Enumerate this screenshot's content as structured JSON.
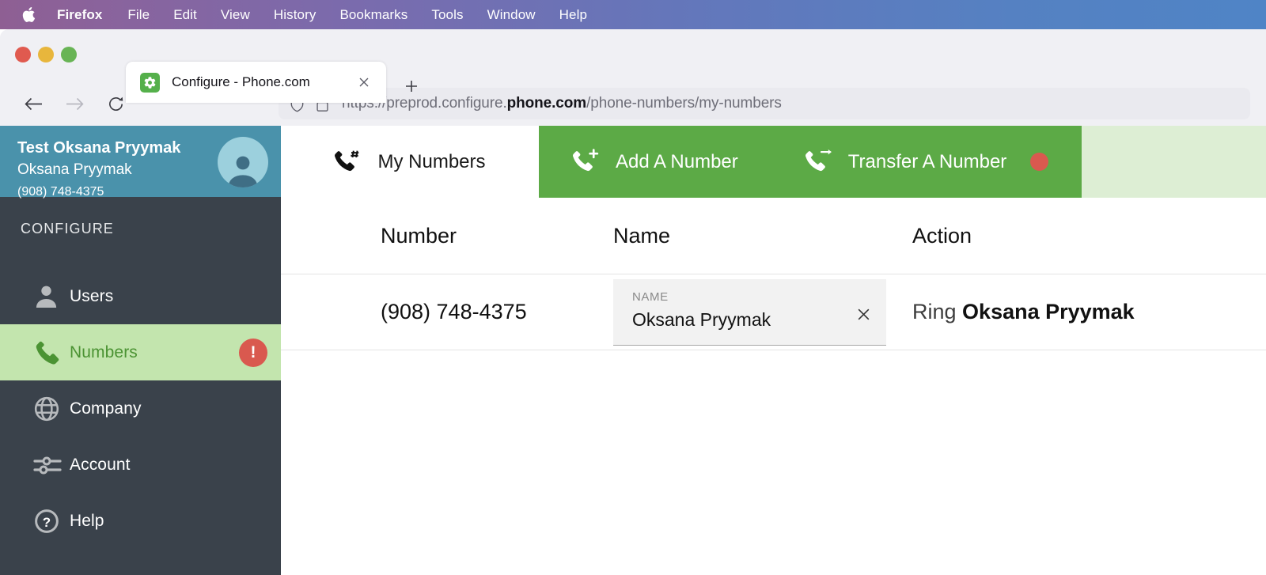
{
  "os_menu": {
    "apple_icon": "apple-logo-icon",
    "items": [
      {
        "label": "Firefox",
        "bold": true
      },
      {
        "label": "File",
        "bold": false
      },
      {
        "label": "Edit",
        "bold": false
      },
      {
        "label": "View",
        "bold": false
      },
      {
        "label": "History",
        "bold": false
      },
      {
        "label": "Bookmarks",
        "bold": false
      },
      {
        "label": "Tools",
        "bold": false
      },
      {
        "label": "Window",
        "bold": false
      },
      {
        "label": "Help",
        "bold": false
      }
    ]
  },
  "browser": {
    "tab": {
      "title": "Configure - Phone.com",
      "favicon_icon": "gear-icon",
      "close_icon": "close-icon"
    },
    "new_tab_icon": "plus-icon",
    "nav": {
      "back_icon": "arrow-left-icon",
      "forward_icon": "arrow-right-icon",
      "reload_icon": "reload-icon"
    },
    "urlbar": {
      "shield_icon": "shield-icon",
      "lock_icon": "lock-icon",
      "url_prefix": "https://preprod.configure.",
      "url_host": "phone.com",
      "url_path": "/phone-numbers/my-numbers"
    }
  },
  "sidebar": {
    "account": {
      "company": "Test Oksana Pryymak",
      "user": "Oksana Pryymak",
      "phone": "(908) 748-4375",
      "avatar_icon": "user-avatar-icon"
    },
    "section_title": "CONFIGURE",
    "items": [
      {
        "label": "Users",
        "icon": "user-icon",
        "active": false,
        "badge": ""
      },
      {
        "label": "Numbers",
        "icon": "phone-icon",
        "active": true,
        "badge": "!"
      },
      {
        "label": "Company",
        "icon": "globe-icon",
        "active": false,
        "badge": ""
      },
      {
        "label": "Account",
        "icon": "sliders-icon",
        "active": false,
        "badge": ""
      },
      {
        "label": "Help",
        "icon": "help-circle-icon",
        "active": false,
        "badge": ""
      }
    ]
  },
  "main": {
    "tabs": [
      {
        "label": "My Numbers",
        "icon": "phone-hash-icon",
        "style": "white",
        "dot": false
      },
      {
        "label": "Add A Number",
        "icon": "phone-plus-icon",
        "style": "green",
        "dot": false
      },
      {
        "label": "Transfer A Number",
        "icon": "phone-transfer-icon",
        "style": "green",
        "dot": true
      }
    ],
    "table": {
      "headers": [
        "Number",
        "Name",
        "Action"
      ],
      "rows": [
        {
          "number": "(908) 748-4375",
          "name_label": "NAME",
          "name_value": "Oksana Pryymak",
          "name_clear_icon": "close-icon",
          "action_prefix": "Ring",
          "action_name": "Oksana Pryymak"
        }
      ]
    }
  },
  "colors": {
    "green": "#5caa46",
    "green_light": "#c3e5ae",
    "green_pale": "#ddeed4",
    "teal": "#4a92ab",
    "sidebar_dark": "#3a424b",
    "red_badge": "#d9594f"
  }
}
